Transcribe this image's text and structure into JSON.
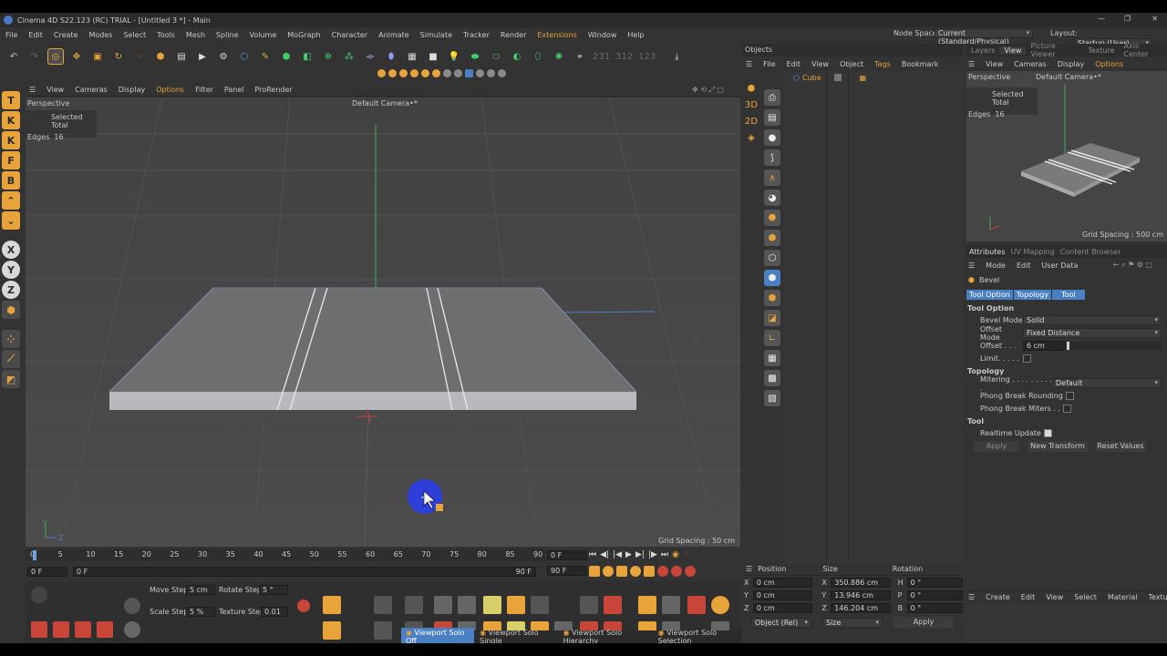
{
  "window": {
    "title": "Cinema 4D S22.123 (RC) TRIAL - [Untitled 3 *] - Main",
    "minimize_glyph": "—",
    "maximize_glyph": "❐",
    "close_glyph": "✕"
  },
  "menubar": {
    "items": [
      "File",
      "Edit",
      "Create",
      "Modes",
      "Select",
      "Tools",
      "Mesh",
      "Spline",
      "Volume",
      "MoGraph",
      "Character",
      "Animate",
      "Simulate",
      "Tracker",
      "Render",
      "Extensions",
      "Window",
      "Help"
    ],
    "node_space_label": "Node Space:",
    "node_space_value": "Current (Standard/Physical)",
    "layout_label": "Layout:",
    "layout_value": "Startup (User)"
  },
  "toolbar": {
    "coord_readout": [
      "231",
      "312",
      "123"
    ]
  },
  "viewport": {
    "menu": [
      "View",
      "Cameras",
      "Display",
      "Options",
      "Filter",
      "Panel",
      "ProRender"
    ],
    "active_menu": "Options",
    "projection": "Perspective",
    "camera": "Default Camera",
    "camera_suffix": "•*",
    "hud_title": "Selected Total",
    "hud_edges_label": "Edges",
    "hud_edges_value": "16",
    "grid_spacing": "Grid Spacing : 50 cm",
    "axis_y": "Y",
    "axis_z": "Z"
  },
  "left_toolbar": {
    "letters": [
      "T",
      "K",
      "K",
      "F",
      "B",
      "⌃",
      "⌄",
      "X",
      "Y",
      "Z"
    ]
  },
  "objects_panel": {
    "title": "Objects",
    "menu": [
      "File",
      "Edit",
      "View",
      "Object",
      "Tags",
      "Bookmark"
    ],
    "active_menu": "Tags",
    "items": [
      {
        "name": "Cube"
      }
    ]
  },
  "right_viewport": {
    "tabs": [
      "Layers",
      "View",
      "Picture Viewer",
      "Texture",
      "Axis Center"
    ],
    "active_tab": "View",
    "menu": [
      "View",
      "Cameras",
      "Display",
      "Options"
    ],
    "active_menu": "Options",
    "projection": "Perspective",
    "camera": "Default Camera",
    "camera_suffix": "•*",
    "hud_title": "Selected Total",
    "hud_edges_label": "Edges",
    "hud_edges_value": "16",
    "grid_spacing": "Grid Spacing : 500 cm"
  },
  "attributes": {
    "tabs": [
      "Attributes",
      "UV Mapping",
      "Content Browser"
    ],
    "active_tab": "Attributes",
    "menu": [
      "Mode",
      "Edit",
      "User Data"
    ],
    "tool_name": "Bevel",
    "subtabs": [
      "Tool Option",
      "Topology",
      "Tool"
    ],
    "section_tool_option": "Tool Option",
    "bevel_mode_label": "Bevel Mode",
    "bevel_mode_value": "Solid",
    "offset_mode_label": "Offset Mode",
    "offset_mode_value": "Fixed Distance",
    "offset_label": "Offset . . .",
    "offset_value": "6 cm",
    "limit_label": "Limit. . . . .",
    "section_topology": "Topology",
    "mitering_label": "Mitering . . . . . . . . . .",
    "mitering_value": "Default",
    "phong_rounding_label": "Phong Break Rounding",
    "phong_miters_label": "Phong Break Miters . .",
    "section_tool": "Tool",
    "realtime_label": "Realtime Update",
    "apply_label": "Apply",
    "new_transform_label": "New Transform",
    "reset_values_label": "Reset Values"
  },
  "timeline": {
    "ticks": [
      "0",
      "5",
      "10",
      "15",
      "20",
      "25",
      "30",
      "35",
      "40",
      "45",
      "50",
      "55",
      "60",
      "65",
      "70",
      "75",
      "80",
      "85",
      "90"
    ],
    "end_frame_marker": "0 F",
    "current_frame": "0 F",
    "start_frame": "0 F",
    "range_end": "90 F",
    "max_frame": "90 F"
  },
  "snap_bar": {
    "move_step_label": "Move Step",
    "move_step_value": "5 cm",
    "rotate_step_label": "Rotate Step",
    "rotate_step_value": "5 °",
    "scale_step_label": "Scale Step",
    "scale_step_value": "5 %",
    "texture_step_label": "Texture Step",
    "texture_step_value": "0.01"
  },
  "coordinates": {
    "headers": [
      "Position",
      "Size",
      "Rotation"
    ],
    "rows": [
      {
        "axis": "X",
        "pos": "0 cm",
        "size_axis": "X",
        "size": "350.886 cm",
        "rot_axis": "H",
        "rot": "0 °"
      },
      {
        "axis": "Y",
        "pos": "0 cm",
        "size_axis": "Y",
        "size": "13.946 cm",
        "rot_axis": "P",
        "rot": "0 °"
      },
      {
        "axis": "Z",
        "pos": "0 cm",
        "size_axis": "Z",
        "size": "146.204 cm",
        "rot_axis": "B",
        "rot": "0 °"
      }
    ],
    "mode_value": "Object (Rel)",
    "size_mode_value": "Size",
    "apply_label": "Apply"
  },
  "materials": {
    "menu": [
      "Create",
      "Edit",
      "View",
      "Select",
      "Material",
      "Texture"
    ]
  },
  "status_bar": {
    "items": [
      "Viewport Solo Off",
      "Viewport Solo Single",
      "Viewport Solo Hierarchy",
      "Viewport Solo Selection"
    ],
    "active": "Viewport Solo Off"
  },
  "colors": {
    "accent_orange": "#e8a33a",
    "active_blue": "#4a7fc1",
    "axis_green": "#3fae5a",
    "axis_red": "#c8453a",
    "cursor_blue": "#2e3fd9"
  }
}
